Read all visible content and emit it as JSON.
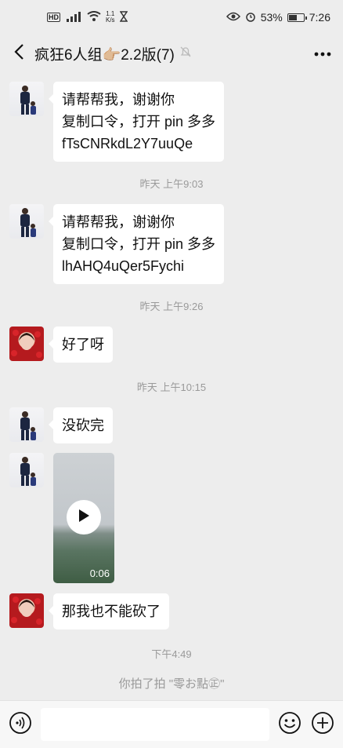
{
  "status_bar": {
    "hd": "HD",
    "signal": "4G",
    "speed_top": "1.1",
    "speed_bottom": "K/s",
    "battery_text": "53%",
    "time": "7:26"
  },
  "header": {
    "title": "疯狂6人组👉🏼2.2版(7)"
  },
  "messages": [
    {
      "sender": "man",
      "lines": [
        "请帮帮我，谢谢你",
        "复制口令，打开 pin 多多",
        "fTsCNRkdL2Y7uuQe"
      ]
    },
    {
      "time": "昨天 上午9:03"
    },
    {
      "sender": "man",
      "lines": [
        "请帮帮我，谢谢你",
        "复制口令，打开 pin 多多",
        "lhAHQ4uQer5Fychi"
      ]
    },
    {
      "time": "昨天 上午9:26"
    },
    {
      "sender": "woman",
      "lines": [
        "好了呀"
      ]
    },
    {
      "time": "昨天 上午10:15"
    },
    {
      "sender": "man",
      "lines": [
        "没砍完"
      ]
    },
    {
      "sender": "man",
      "video_duration": "0:06"
    },
    {
      "sender": "woman",
      "lines": [
        "那我也不能砍了"
      ]
    },
    {
      "time": "下午4:49"
    },
    {
      "system": "你拍了拍 \"零お點㊣\""
    }
  ],
  "icons": {
    "back": "chevron-left-icon",
    "mute": "bell-off-icon",
    "more": "more-dots-icon",
    "voice": "voice-icon",
    "emoji": "emoji-icon",
    "add": "plus-circle-icon",
    "play": "play-icon"
  },
  "colors": {
    "background": "#ededed",
    "bubble": "#ffffff",
    "timestamp": "#9a9a9a"
  }
}
